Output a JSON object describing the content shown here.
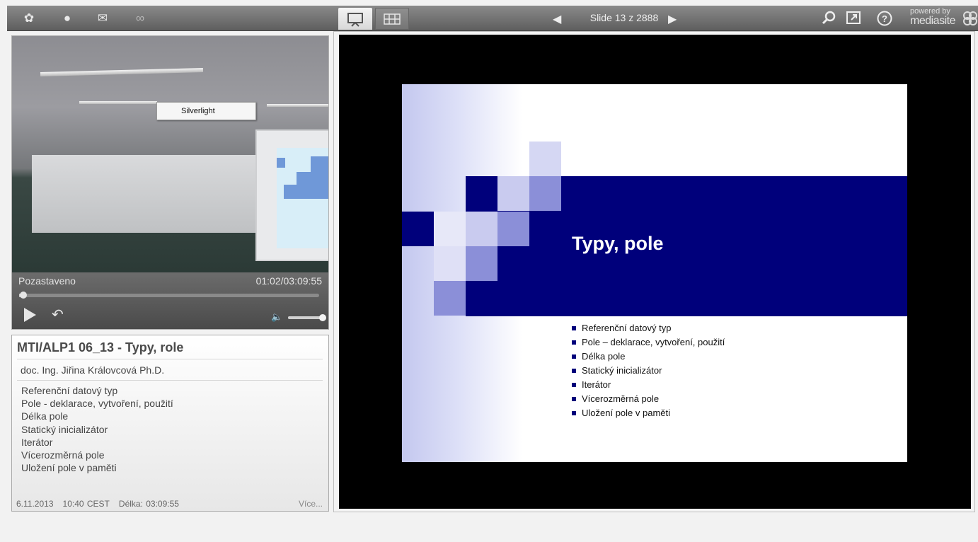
{
  "toolbar": {
    "icons": [
      "share-icon",
      "chat-icon",
      "mail-icon",
      "attachment-icon"
    ],
    "slide_counter": "Slide 13 z 2888",
    "powered_by": "powered by",
    "brand": "mediasite"
  },
  "player": {
    "context_menu_item": "Silverlight",
    "status": "Pozastaveno",
    "time": "01:02/03:09:55",
    "progress_fraction": 0.005,
    "volume_fraction": 1.0
  },
  "info": {
    "title": "MTI/ALP1 06_13 - Typy, role",
    "presenter": "doc. Ing. Jiřina Královcová Ph.D.",
    "topics": [
      "Referenční datový typ",
      "Pole - deklarace, vytvoření, použití",
      "Délka pole",
      "Statický inicializátor",
      "Iterátor",
      "Vícerozměrná pole",
      "Uložení pole v paměti"
    ],
    "date": "6.11.2013",
    "time": "10:40 CEST",
    "duration": "Délka: 03:09:55",
    "more": "Více..."
  },
  "slide": {
    "title": "Typy, pole",
    "bullets": [
      "Referenční datový typ",
      "Pole – deklarace, vytvoření, použití",
      "Délka pole",
      "Statický inicializátor",
      "Iterátor",
      "Vícerozměrná pole",
      "Uložení pole v paměti"
    ],
    "accent_color": "#00007b"
  }
}
